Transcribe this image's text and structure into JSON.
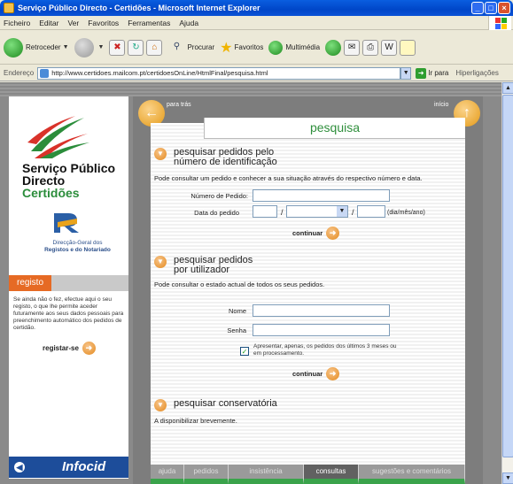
{
  "window": {
    "title": "Serviço Público Directo - Certidões - Microsoft Internet Explorer",
    "controls": [
      "_",
      "□",
      "×"
    ]
  },
  "menu": [
    "Ficheiro",
    "Editar",
    "Ver",
    "Favoritos",
    "Ferramentas",
    "Ajuda"
  ],
  "toolbar": {
    "back_label": "Retroceder",
    "search_label": "Procurar",
    "favorites_label": "Favoritos",
    "multimedia_label": "Multimédia"
  },
  "address": {
    "label": "Endereço",
    "url": "http://www.certidoes.mailcom.pt/certidoesOnLine/HtmlFinal/pesquisa.html",
    "go_label": "Ir para",
    "links_label": "Hiperligações"
  },
  "sidebar": {
    "brand_line1": "Serviço Público",
    "brand_line2": "Directo",
    "brand_line3": "Certidões",
    "dg_line1": "Direcção-Geral dos",
    "dg_line2": "Registos e do Notariado",
    "registo_tab": "registo",
    "registo_text": "Se ainda não o fez, efectue aqui o seu registo, o que lhe permite aceder futuramente aos seus dados pessoais para preenchimento automático dos pedidos de certidão.",
    "registo_link": "registar-se",
    "infocid": "Infocid"
  },
  "page": {
    "back_label": "para trás",
    "home_label": "início",
    "title": "pesquisa",
    "section1": {
      "title_line1": "pesquisar pedidos pelo",
      "title_line2": "número de identificação",
      "desc": "Pode consultar um pedido e conhecer a sua situação através do respectivo número e data.",
      "order_label": "Número de Pedido:",
      "date_label": "Data do pedido",
      "date_hint": "(dia/mês/ano)",
      "continue_label": "continuar"
    },
    "section2": {
      "title_line1": "pesquisar pedidos",
      "title_line2": "por utilizador",
      "desc": "Pode consultar o estado actual de todos os seus pedidos.",
      "name_label": "Nome",
      "password_label": "Senha",
      "checkbox_text": "Apresentar, apenas, os pedidos dos últimos 3 meses ou em processamento.",
      "checkbox_checked": true,
      "continue_label": "continuar"
    },
    "section3": {
      "title": "pesquisar conservatória",
      "desc": "A disponibilizar brevemente."
    },
    "tabs": [
      "ajuda",
      "pedidos",
      "insistência",
      "consultas",
      "sugestões e comentários"
    ],
    "active_tab": "consultas"
  },
  "colors": {
    "accent_orange": "#e49a18",
    "brand_green": "#2f8f3c",
    "infocid_blue": "#1d4d9a",
    "tab_green": "#3aa34b"
  }
}
